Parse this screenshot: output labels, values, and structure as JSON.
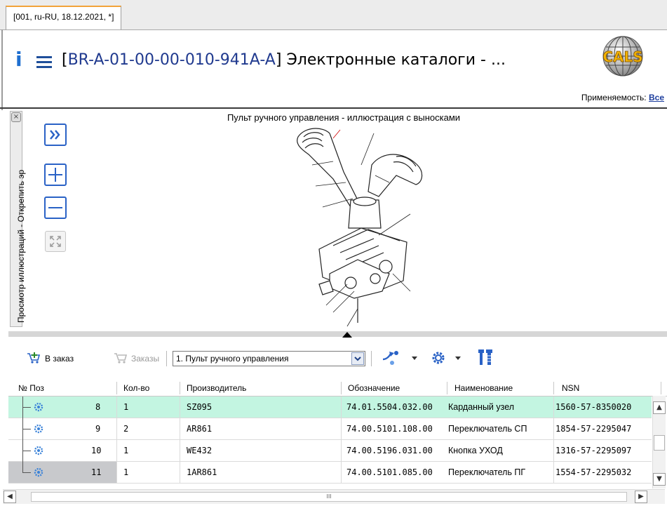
{
  "tab": {
    "label": "[001, ru-RU, 18.12.2021, *]"
  },
  "header": {
    "code": "BR-A-01-00-00-010-941A-A",
    "title": "Электронные каталоги - ...",
    "logo_text": "CALS",
    "applicability_label": "Применяемость:",
    "applicability_value": "Все"
  },
  "side_panel": {
    "label": "Просмотр иллюстраций - Открепить эр"
  },
  "illustration": {
    "title": "Пульт ручного управления - иллюстрация с выносками"
  },
  "toolbar": {
    "add_to_order": "В заказ",
    "orders": "Заказы",
    "selected_figure": "1. Пульт ручного управления"
  },
  "table": {
    "columns": [
      "№ Поз",
      "Кол-во",
      "Производитель",
      "Обозначение",
      "Наименование",
      "NSN"
    ],
    "rows": [
      {
        "pos": "8",
        "qty": "1",
        "mfr": "SZ095",
        "designation": "74.01.5504.032.00",
        "name": "Карданный узел",
        "nsn": "1560-57-8350020"
      },
      {
        "pos": "9",
        "qty": "2",
        "mfr": "AR861",
        "designation": "74.00.5101.108.00",
        "name": "Переключатель СП",
        "nsn": "1854-57-2295047"
      },
      {
        "pos": "10",
        "qty": "1",
        "mfr": "WE432",
        "designation": "74.00.5196.031.00",
        "name": "Кнопка УХОД",
        "nsn": "1316-57-2295097"
      },
      {
        "pos": "11",
        "qty": "1",
        "mfr": "1AR861",
        "designation": "74.00.5101.085.00",
        "name": "Переключатель ПГ",
        "nsn": "1554-57-2295032"
      }
    ]
  },
  "colors": {
    "selected_row": "#c3f5e1",
    "current_row": "#c8c9cc",
    "accent": "#2a62c6"
  },
  "hscroll": {
    "grip": "III"
  }
}
